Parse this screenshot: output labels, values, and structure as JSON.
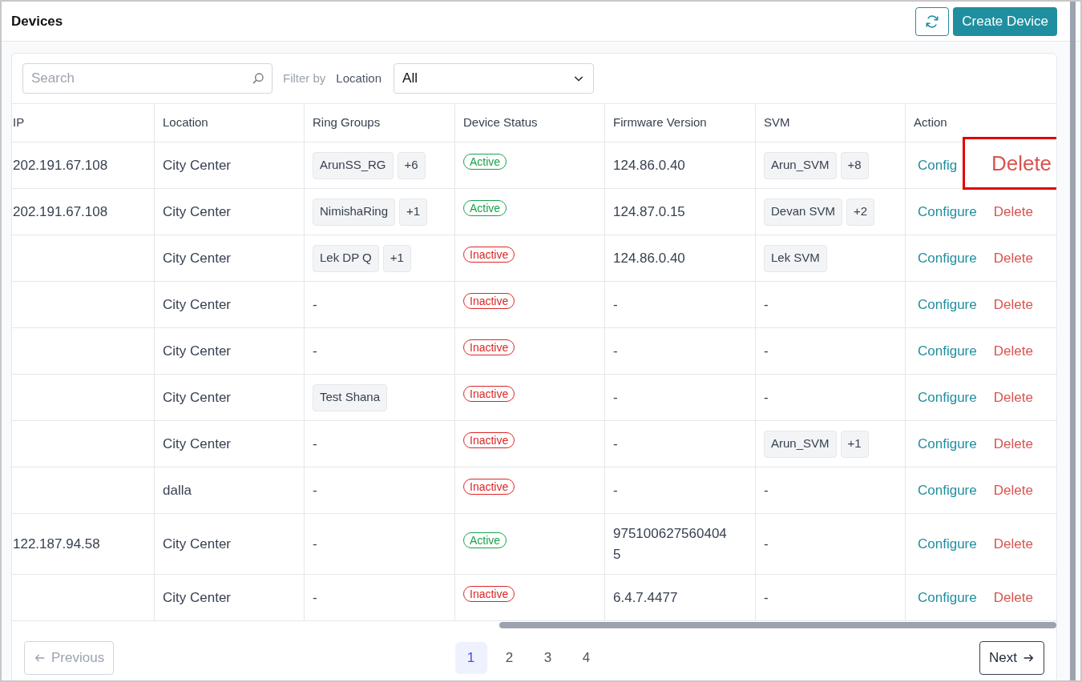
{
  "header": {
    "title": "Devices",
    "create_button": "Create Device"
  },
  "filters": {
    "search_placeholder": "Search",
    "filter_label": "Filter by",
    "location_label": "Location",
    "location_value": "All"
  },
  "table": {
    "columns": [
      "IP",
      "Location",
      "Ring Groups",
      "Device Status",
      "Firmware Version",
      "SVM",
      "Action"
    ],
    "rows": [
      {
        "ip": "202.191.67.108",
        "location": "City Center",
        "ring_groups": {
          "tags": [
            "ArunSS_RG",
            "+6"
          ]
        },
        "status": "Active",
        "active": true,
        "firmware": "124.86.0.40",
        "svm": {
          "tags": [
            "Arun_SVM",
            "+8"
          ]
        },
        "configure": "Config",
        "delete": "Delete",
        "highlighted": true
      },
      {
        "ip": "202.191.67.108",
        "location": "City Center",
        "ring_groups": {
          "tags": [
            "NimishaRing",
            "+1"
          ]
        },
        "status": "Active",
        "active": true,
        "firmware": "124.87.0.15",
        "svm": {
          "tags": [
            "Devan SVM",
            "+2"
          ]
        },
        "configure": "Configure",
        "delete": "Delete",
        "highlighted": false
      },
      {
        "location": "City Center",
        "ring_groups": {
          "tags": [
            "Lek DP Q",
            "+1"
          ]
        },
        "status": "Inactive",
        "active": false,
        "firmware": "124.86.0.40",
        "svm": {
          "tags": [
            "Lek SVM"
          ]
        },
        "configure": "Configure",
        "delete": "Delete",
        "highlighted": false
      },
      {
        "location": "City Center",
        "ring_groups": {
          "text": "-"
        },
        "status": "Inactive",
        "active": false,
        "firmware": "-",
        "svm": {
          "text": "-"
        },
        "configure": "Configure",
        "delete": "Delete",
        "highlighted": false
      },
      {
        "location": "City Center",
        "ring_groups": {
          "text": "-"
        },
        "status": "Inactive",
        "active": false,
        "firmware": "-",
        "svm": {
          "text": "-"
        },
        "configure": "Configure",
        "delete": "Delete",
        "highlighted": false
      },
      {
        "location": "City Center",
        "ring_groups": {
          "tags": [
            "Test Shana"
          ]
        },
        "status": "Inactive",
        "active": false,
        "firmware": "-",
        "svm": {
          "text": "-"
        },
        "configure": "Configure",
        "delete": "Delete",
        "highlighted": false
      },
      {
        "location": "City Center",
        "ring_groups": {
          "text": "-"
        },
        "status": "Inactive",
        "active": false,
        "firmware": "-",
        "svm": {
          "tags": [
            "Arun_SVM",
            "+1"
          ]
        },
        "configure": "Configure",
        "delete": "Delete",
        "highlighted": false
      },
      {
        "location": "dalla",
        "ring_groups": {
          "text": "-"
        },
        "status": "Inactive",
        "active": false,
        "firmware": "-",
        "svm": {
          "text": "-"
        },
        "configure": "Configure",
        "delete": "Delete",
        "highlighted": false
      },
      {
        "ip": "122.187.94.58",
        "location": "City Center",
        "ring_groups": {
          "text": "-"
        },
        "status": "Active",
        "active": true,
        "firmware": "9751006275604045",
        "svm": {
          "text": "-"
        },
        "configure": "Configure",
        "delete": "Delete",
        "highlighted": false
      },
      {
        "location": "City Center",
        "ring_groups": {
          "text": "-"
        },
        "status": "Inactive",
        "active": false,
        "firmware": "6.4.7.4477",
        "svm": {
          "text": "-"
        },
        "configure": "Configure",
        "delete": "Delete",
        "highlighted": false
      }
    ]
  },
  "pagination": {
    "previous": "Previous",
    "previous_disabled": true,
    "pages": [
      {
        "label": "1",
        "selected": true
      },
      {
        "label": "2",
        "selected": false
      },
      {
        "label": "3",
        "selected": false
      },
      {
        "label": "4",
        "selected": false
      }
    ],
    "next": "Next"
  }
}
